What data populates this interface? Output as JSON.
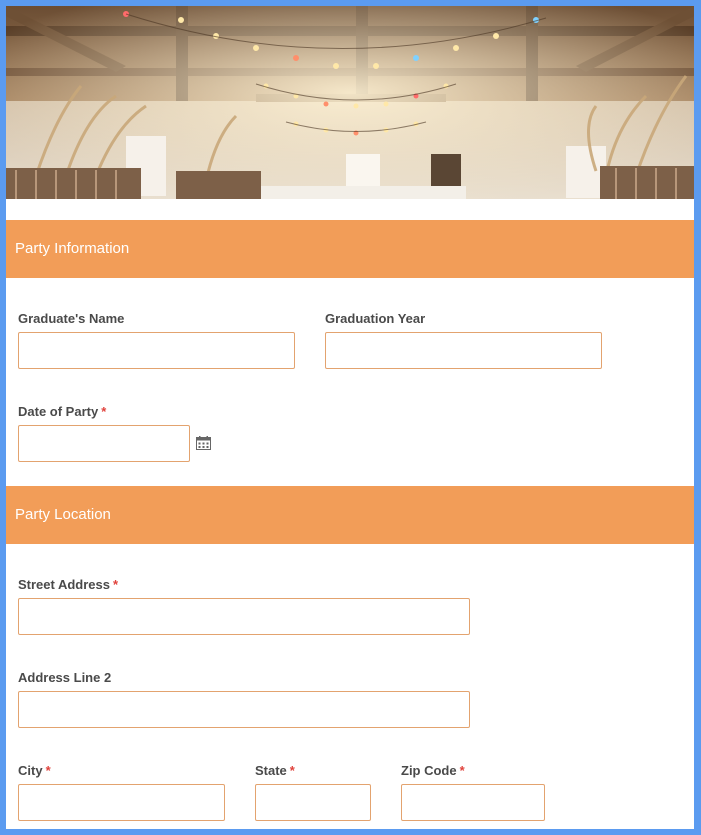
{
  "sections": {
    "party_info": "Party Information",
    "party_location": "Party Location"
  },
  "fields": {
    "graduate_name": {
      "label": "Graduate's Name",
      "value": "",
      "required": false
    },
    "graduation_year": {
      "label": "Graduation Year",
      "value": "",
      "required": false
    },
    "date_of_party": {
      "label": "Date of Party",
      "value": "",
      "required": true
    },
    "street_address": {
      "label": "Street Address",
      "value": "",
      "required": true
    },
    "address_line2": {
      "label": "Address Line 2",
      "value": "",
      "required": false
    },
    "city": {
      "label": "City",
      "value": "",
      "required": true
    },
    "state": {
      "label": "State",
      "value": "",
      "required": true
    },
    "zip_code": {
      "label": "Zip Code",
      "value": "",
      "required": true
    }
  },
  "required_marker": "*",
  "icons": {
    "date_picker": "calendar-icon"
  },
  "colors": {
    "accent": "#f29d58",
    "frame_border": "#5b9bf0",
    "required": "#e0413b",
    "field_border": "#e3a36f"
  }
}
